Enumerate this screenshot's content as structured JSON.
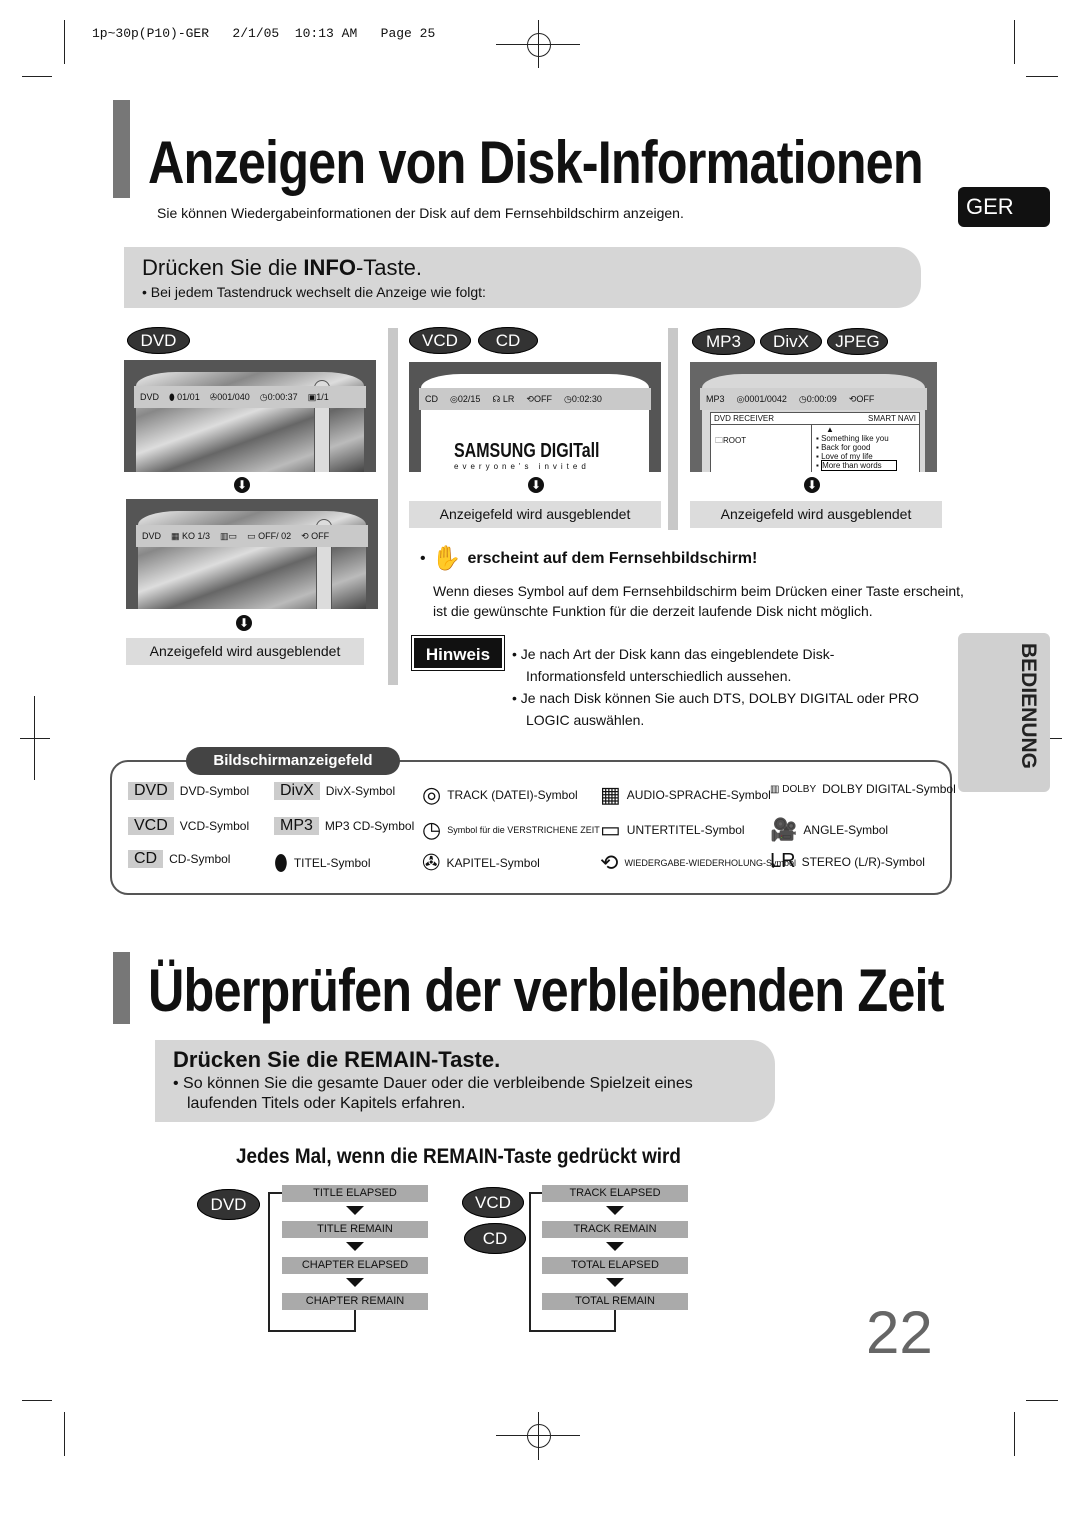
{
  "print_header": "1p~30p(P10)-GER   2/1/05  10:13 AM   Page 25",
  "language_tab": "GER",
  "section_tab": "BEDIENUNG",
  "page_number": "22",
  "section1": {
    "title": "Anzeigen von Disk-Informationen",
    "subtitle": "Sie können Wiedergabeinformationen der Disk auf dem Fernsehbildschirm anzeigen.",
    "step_prefix": "Drücken Sie die ",
    "step_key": "INFO",
    "step_suffix": "-Taste.",
    "step_bullet": "Bei jedem Tastendruck wechselt die Anzeige wie folgt:",
    "badges": {
      "dvd": "DVD",
      "vcd": "VCD",
      "cd": "CD",
      "mp3": "MP3",
      "divx": "DivX",
      "jpeg": "JPEG"
    },
    "dvd_screen1": {
      "disc": "DVD",
      "title": "01/01",
      "chapter": "001/040",
      "time": "0:00:37",
      "angle": "1/1"
    },
    "dvd_screen2": {
      "disc": "DVD",
      "audio": "KO 1/3",
      "subtitle": "OFF/  02",
      "repeat": "OFF"
    },
    "cd_screen": {
      "disc": "CD",
      "track": "02/15",
      "stereo": "LR",
      "repeat": "OFF",
      "time": "0:02:30",
      "logo": "SAMSUNG DIGITall",
      "slogan": "everyone's invited"
    },
    "mp3_screen": {
      "disc": "MP3",
      "track": "0001/0042",
      "time": "0:00:09",
      "repeat": "OFF",
      "header_left": "DVD RECEIVER",
      "header_right": "SMART NAVI",
      "folder": "ROOT",
      "files": [
        "Something like you",
        "Back for good",
        "Love of my life",
        "More than words"
      ]
    },
    "hidden_label": "Anzeigefeld wird ausgeblendet",
    "hand_note": "erscheint auf dem Fernsehbildschirm!",
    "hand_text": "Wenn dieses Symbol auf dem Fernsehbildschirm beim Drücken einer Taste erscheint, ist die gewünschte Funktion für die derzeit laufende Disk nicht möglich.",
    "hinweis_label": "Hinweis",
    "hinweis": [
      "Je nach Art der Disk kann das eingeblendete Disk-Informationsfeld unterschiedlich aussehen.",
      "Je nach Disk können Sie auch DTS, DOLBY DIGITAL oder PRO LOGIC auswählen."
    ],
    "legend_title": "Bildschirmanzeigefeld",
    "legend": [
      {
        "icon": "DVD",
        "label": "DVD-Symbol"
      },
      {
        "icon": "VCD",
        "label": "VCD-Symbol"
      },
      {
        "icon": "CD",
        "label": "CD-Symbol"
      },
      {
        "icon": "DivX",
        "label": "DivX-Symbol"
      },
      {
        "icon": "MP3",
        "label": "MP3 CD-Symbol"
      },
      {
        "icon": "title-icon",
        "label": "TITEL-Symbol"
      },
      {
        "icon": "track-icon",
        "label": "TRACK (DATEI)-Symbol"
      },
      {
        "icon": "elapsed-time-icon",
        "label": "Symbol für die VERSTRICHENE ZEIT"
      },
      {
        "icon": "chapter-icon",
        "label": "KAPITEL-Symbol"
      },
      {
        "icon": "audio-language-icon",
        "label": "AUDIO-SPRACHE-Symbol"
      },
      {
        "icon": "subtitle-icon",
        "label": "UNTERTITEL-Symbol"
      },
      {
        "icon": "repeat-icon",
        "label": "WIEDERGABE-WIEDERHOLUNG-Symbol"
      },
      {
        "icon": "dolby-digital-icon",
        "label": "DOLBY DIGITAL-Symbol"
      },
      {
        "icon": "angle-icon",
        "label": "ANGLE-Symbol"
      },
      {
        "icon": "LR",
        "label": "STEREO (L/R)-Symbol"
      }
    ]
  },
  "section2": {
    "title": "Überprüfen der verbleibenden Zeit",
    "step": "Drücken Sie die REMAIN-Taste.",
    "step_bullet": "So können Sie die gesamte Dauer oder die verbleibende Spielzeit eines laufenden Titels oder Kapitels erfahren.",
    "caption": "Jedes Mal, wenn die REMAIN-Taste gedrückt wird",
    "dvd_flow": [
      "TITLE ELAPSED",
      "TITLE REMAIN",
      "CHAPTER ELAPSED",
      "CHAPTER REMAIN"
    ],
    "cd_flow": [
      "TRACK ELAPSED",
      "TRACK REMAIN",
      "TOTAL ELAPSED",
      "TOTAL REMAIN"
    ]
  }
}
